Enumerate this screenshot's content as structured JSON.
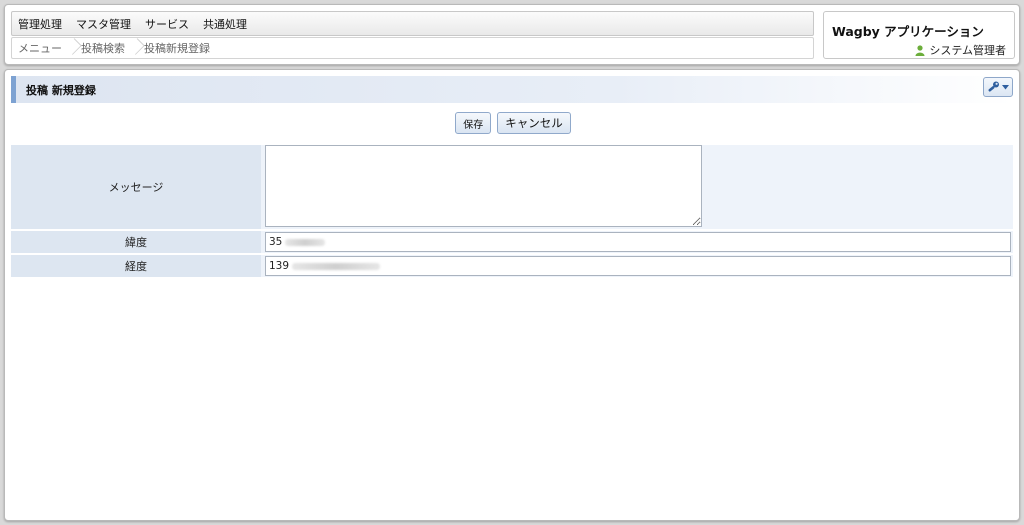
{
  "menubar": {
    "items": [
      "管理処理",
      "マスタ管理",
      "サービス",
      "共通処理"
    ]
  },
  "breadcrumb": {
    "items": [
      "メニュー",
      "投稿検索",
      "投稿新規登録"
    ]
  },
  "app": {
    "title": "Wagby アプリケーション",
    "user_label": "システム管理者",
    "user_icon": "user-icon"
  },
  "section": {
    "title": "投稿 新規登録",
    "tool_icon": "wrench-icon"
  },
  "actions": {
    "save_label": "保存",
    "cancel_label": "キャンセル"
  },
  "form": {
    "message": {
      "label": "メッセージ",
      "value": ""
    },
    "latitude": {
      "label": "緯度",
      "value": "35"
    },
    "longitude": {
      "label": "経度",
      "value": "139"
    }
  },
  "colors": {
    "section_accent": "#7da2d2",
    "label_bg": "#dde6f1",
    "value_bg": "#eef3fa",
    "user_icon": "#6cae3b"
  }
}
